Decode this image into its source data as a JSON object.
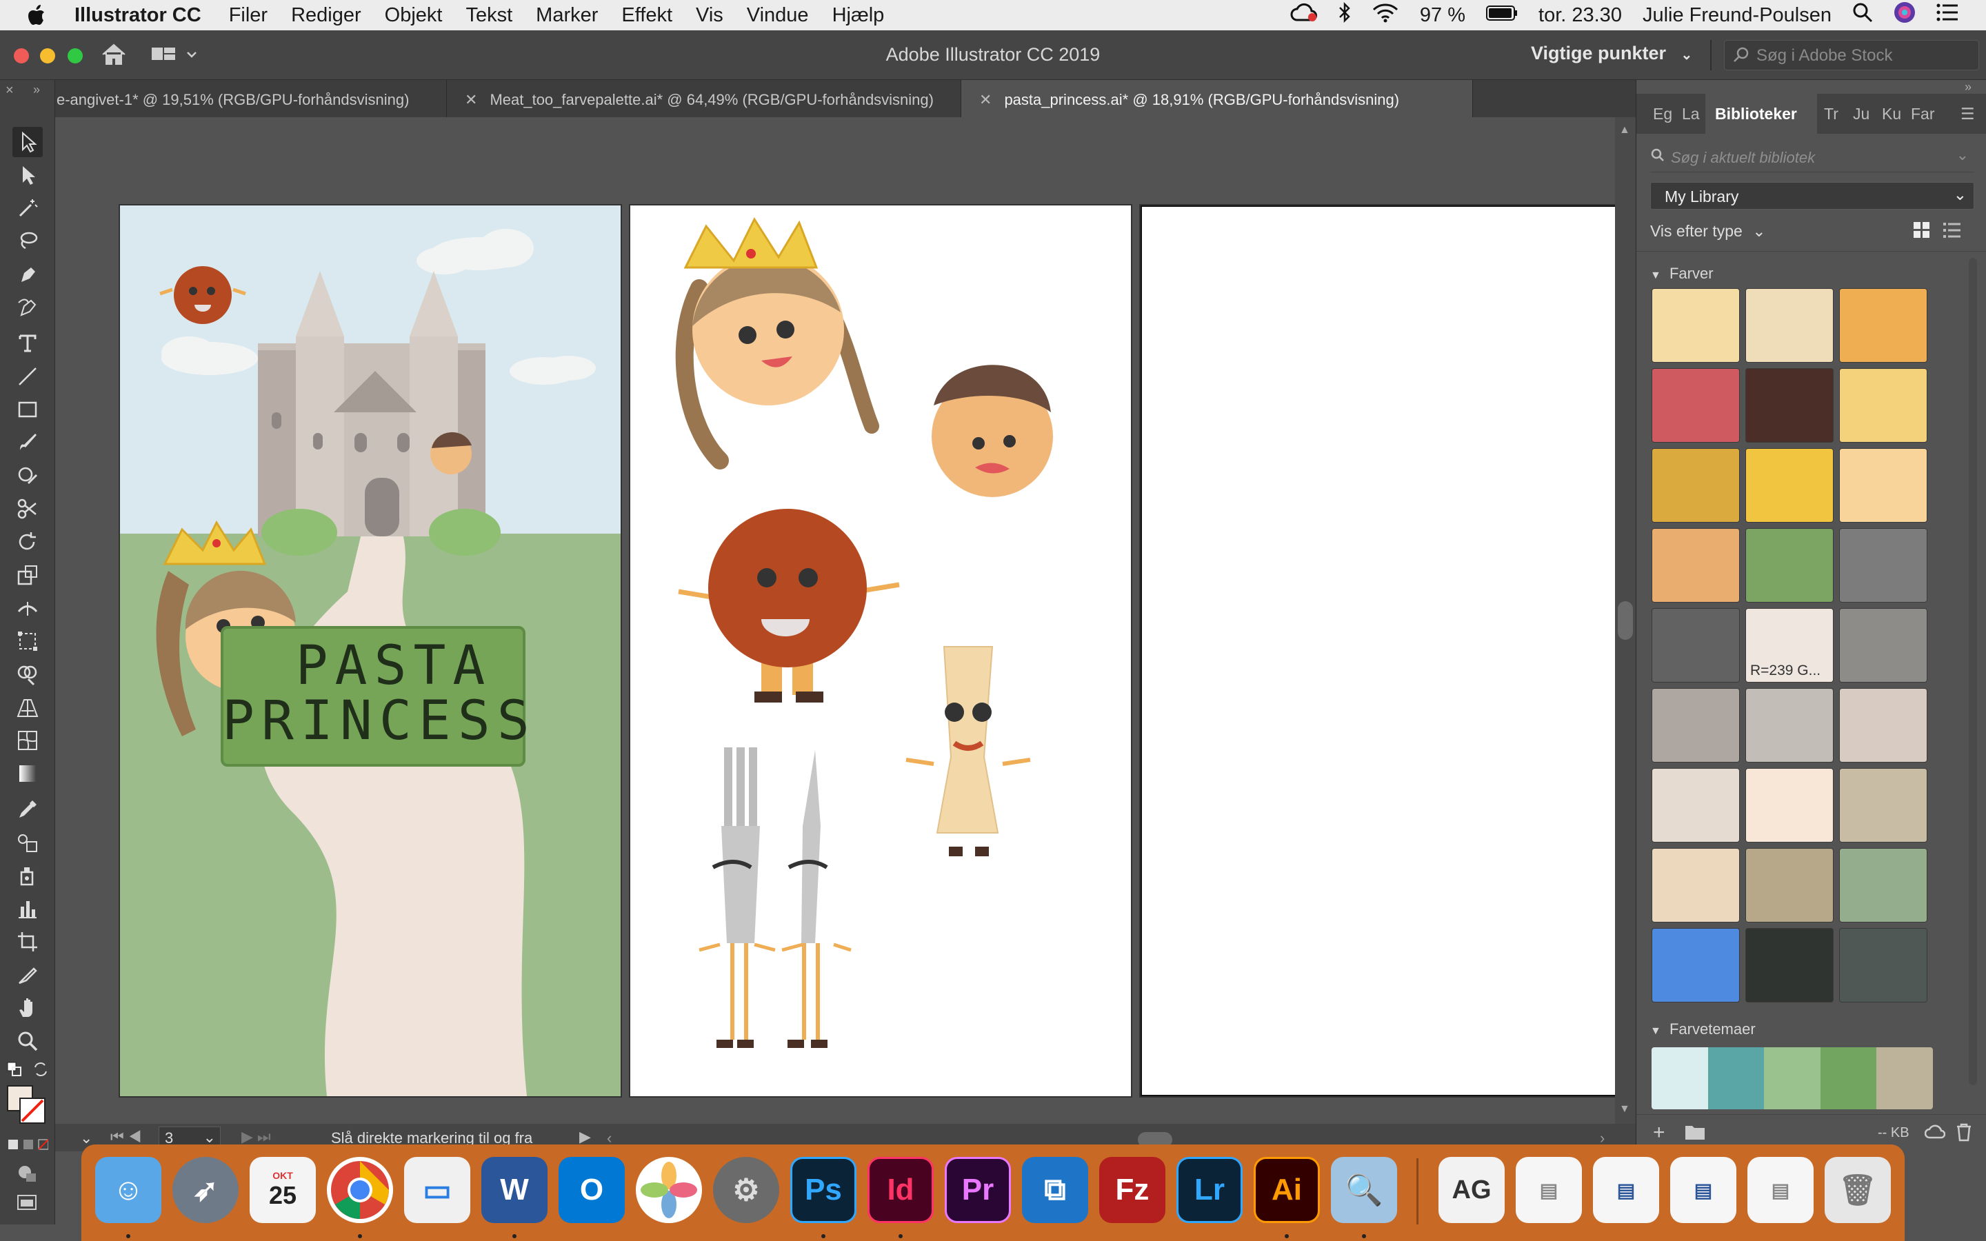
{
  "menubar": {
    "app": "Illustrator CC",
    "items": [
      "Filer",
      "Rediger",
      "Objekt",
      "Tekst",
      "Marker",
      "Effekt",
      "Vis",
      "Vindue",
      "Hjælp"
    ],
    "battery": "97 %",
    "clock": "tor. 23.30",
    "user": "Julie Freund-Poulsen"
  },
  "titlebar": {
    "title": "Adobe Illustrator CC 2019",
    "workspace": "Vigtige punkter",
    "stock_placeholder": "Søg i Adobe Stock"
  },
  "tabs": [
    {
      "label": "e-angivet-1* @ 19,51% (RGB/GPU-forhåndsvisning)"
    },
    {
      "label": "Meat_too_farvepalette.ai* @ 64,49% (RGB/GPU-forhåndsvisning)"
    },
    {
      "label": "pasta_princess.ai* @ 18,91% (RGB/GPU-forhåndsvisning)"
    }
  ],
  "artwork": {
    "poster_title_line1": "PASTA",
    "poster_title_line2": "PRINCESS"
  },
  "statusbar": {
    "artboard_number": "3",
    "hint": "Slå direkte markering til og fra"
  },
  "panel": {
    "tabs": [
      "Eg",
      "La",
      "Biblioteker",
      "Tr",
      "Ju",
      "Ku",
      "Far"
    ],
    "search_placeholder": "Søg i aktuelt bibliotek",
    "library": "My Library",
    "view_by": "Vis efter type",
    "colors_header": "Farver",
    "themes_header": "Farvetemaer",
    "size_label": "-- KB",
    "swatches": [
      {
        "color": "#f5dba4"
      },
      {
        "color": "#efdcb8"
      },
      {
        "color": "#efae52"
      },
      {
        "color": "#cf5a60"
      },
      {
        "color": "#4c2e28"
      },
      {
        "color": "#f4d27c"
      },
      {
        "color": "#dbaa3f"
      },
      {
        "color": "#f2c540"
      },
      {
        "color": "#f9d49a"
      },
      {
        "color": "#e8ad6f"
      },
      {
        "color": "#7ca463"
      },
      {
        "color": "#7c7c7c"
      },
      {
        "color": "#626262"
      },
      {
        "color": "#efe6df",
        "label": "R=239 G..."
      },
      {
        "color": "#8e8c88"
      },
      {
        "color": "#aea7a1"
      },
      {
        "color": "#c3bdb7"
      },
      {
        "color": "#d8ccc2"
      },
      {
        "color": "#e6dbd0"
      },
      {
        "color": "#f8e7d6"
      },
      {
        "color": "#c8bca4"
      },
      {
        "color": "#ecd8bc"
      },
      {
        "color": "#b7a88a"
      },
      {
        "color": "#94ad8c"
      },
      {
        "color": "#4e8ae0"
      },
      {
        "color": "#303430"
      },
      {
        "color": "#4f5854"
      }
    ],
    "theme_colors": [
      "#dbeeef",
      "#5aa6a6",
      "#9ac28f",
      "#72a660",
      "#bdb39a"
    ]
  }
}
